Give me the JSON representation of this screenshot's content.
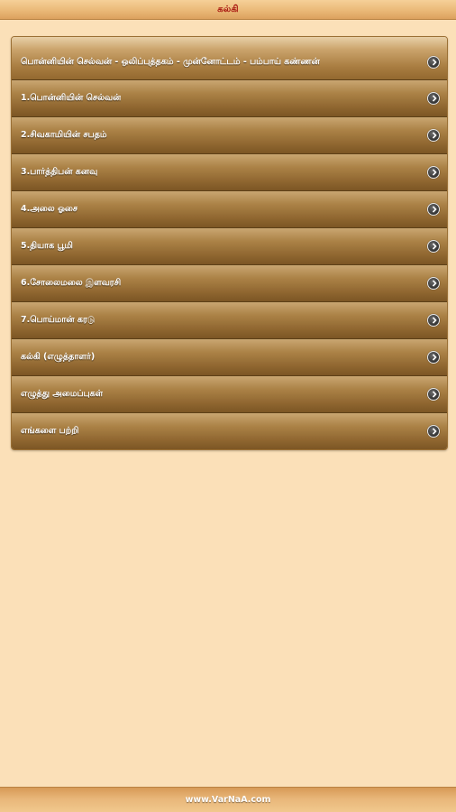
{
  "header": {
    "title": "கல்கி"
  },
  "menu": {
    "items": [
      {
        "label": "பொன்னியின் செல்வன் - ஒலிப்புத்தகம் - முன்னோட்டம் - பம்பாய் கண்ணன்"
      },
      {
        "label": "1.பொன்னியின் செல்வன்"
      },
      {
        "label": "2.சிவகாமியின் சபதம்"
      },
      {
        "label": "3.பார்த்திபன் கனவு"
      },
      {
        "label": "4.அலை ஓசை"
      },
      {
        "label": "5.தியாக பூமி"
      },
      {
        "label": "6.சோலைமலை இளவரசி"
      },
      {
        "label": "7.பொய்மான் கரடு"
      },
      {
        "label": "கல்கி (எழுத்தாளர்)"
      },
      {
        "label": "எழுத்து அமைப்புகள்"
      },
      {
        "label": "எங்களை பற்றி"
      }
    ]
  },
  "footer": {
    "text": "www.VarNaA.com"
  }
}
